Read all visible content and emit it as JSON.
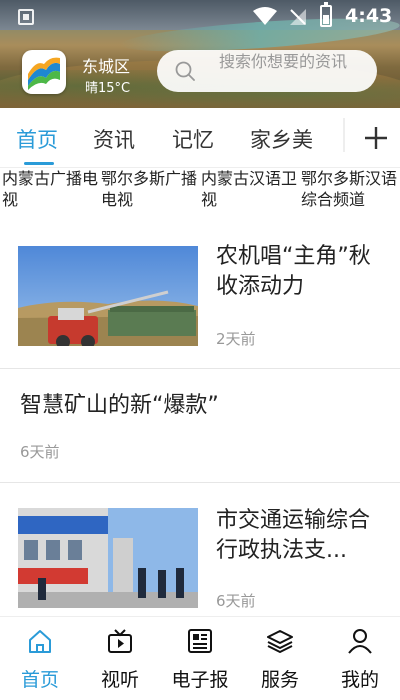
{
  "status_bar": {
    "time": "4:43"
  },
  "header": {
    "location": "东城区",
    "weather": "晴15°C",
    "search_placeholder": "搜索你想要的资讯"
  },
  "tabs": [
    {
      "label": "首页",
      "active": true
    },
    {
      "label": "资讯",
      "active": false
    },
    {
      "label": "记忆",
      "active": false
    },
    {
      "label": "家乡美",
      "active": false
    }
  ],
  "channels": [
    "内蒙古广播电视",
    "鄂尔多斯广播电视",
    "内蒙古汉语卫视",
    "鄂尔多斯汉语综合频道"
  ],
  "news": [
    {
      "title": "农机唱“主角”秋收添动力",
      "time": "2天前",
      "has_image": true,
      "image": "harvester-photo"
    },
    {
      "title": "智慧矿山的新“爆款”",
      "time": "6天前",
      "has_image": false
    },
    {
      "title": "市交通运输综合行政执法支...",
      "time": "6天前",
      "has_image": true,
      "image": "street-event-photo"
    }
  ],
  "bottom_nav": [
    {
      "label": "首页",
      "icon": "home-icon",
      "active": true
    },
    {
      "label": "视听",
      "icon": "video-icon",
      "active": false
    },
    {
      "label": "电子报",
      "icon": "newspaper-icon",
      "active": false
    },
    {
      "label": "服务",
      "icon": "layers-icon",
      "active": false
    },
    {
      "label": "我的",
      "icon": "person-icon",
      "active": false
    }
  ],
  "colors": {
    "accent": "#2a9bd8",
    "text": "#222222",
    "muted": "#999999"
  }
}
